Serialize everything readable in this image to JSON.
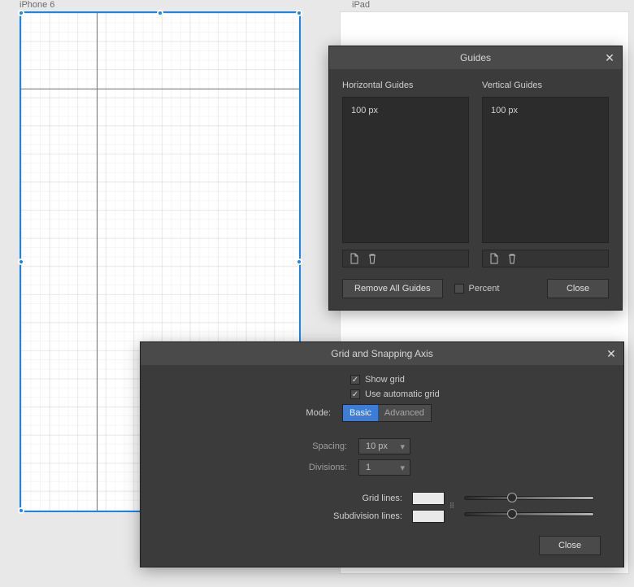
{
  "artboards": {
    "iphone_label": "iPhone 6",
    "ipad_label": "iPad"
  },
  "guides_panel": {
    "title": "Guides",
    "horizontal_label": "Horizontal Guides",
    "vertical_label": "Vertical Guides",
    "horizontal_items": [
      "100 px"
    ],
    "vertical_items": [
      "100 px"
    ],
    "remove_all_label": "Remove All Guides",
    "percent_label": "Percent",
    "percent_checked": false,
    "close_label": "Close"
  },
  "grid_panel": {
    "title": "Grid and Snapping Axis",
    "show_grid_label": "Show grid",
    "show_grid_checked": true,
    "use_automatic_grid_label": "Use automatic grid",
    "use_automatic_grid_checked": true,
    "mode_label": "Mode:",
    "mode_basic": "Basic",
    "mode_advanced": "Advanced",
    "mode_selected": "basic",
    "spacing_label": "Spacing:",
    "spacing_value": "10 px",
    "divisions_label": "Divisions:",
    "divisions_value": "1",
    "grid_lines_label": "Grid lines:",
    "subdivision_lines_label": "Subdivision lines:",
    "grid_lines_color": "#e9e9e9",
    "subdivision_lines_color": "#e9e9e9",
    "grid_lines_slider_pct": 33,
    "subdivision_lines_slider_pct": 33,
    "close_label": "Close"
  }
}
